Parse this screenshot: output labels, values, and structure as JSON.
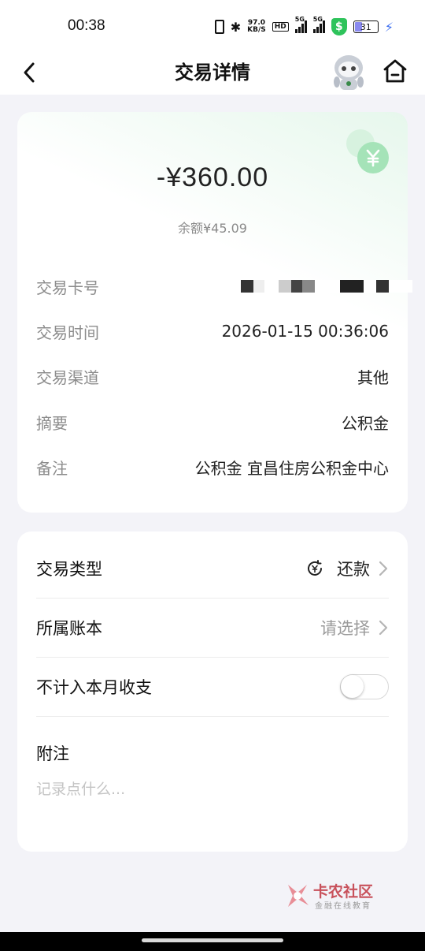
{
  "status_bar": {
    "time": "00:38",
    "net_speed_value": "97.0",
    "net_speed_unit": "KB/S",
    "hd_label": "HD",
    "signal1_label": "5G",
    "signal2_label": "5G",
    "shield_symbol": "$",
    "battery_level": "31",
    "icons": [
      "vibrate-icon",
      "bluetooth-icon",
      "hd-icon",
      "signal-icon",
      "signal-icon",
      "security-shield-icon",
      "battery-icon",
      "charging-icon"
    ]
  },
  "header": {
    "title": "交易详情",
    "back_icon": "chevron-left-icon",
    "assistant_icon": "robot-assistant-icon",
    "home_icon": "home-icon"
  },
  "transaction": {
    "amount": "-¥360.00",
    "balance": "余额¥45.09",
    "category_icon": "yuan-coin-icon",
    "rows": [
      {
        "label": "交易卡号",
        "value": ""
      },
      {
        "label": "交易时间",
        "value": "2026-01-15 00:36:06"
      },
      {
        "label": "交易渠道",
        "value": "其他"
      },
      {
        "label": "摘要",
        "value": "公积金"
      },
      {
        "label": "备注",
        "value": "公积金 宜昌住房公积金中心"
      }
    ]
  },
  "settings": {
    "type_label": "交易类型",
    "type_value": "还款",
    "account_label": "所属账本",
    "account_value": "请选择",
    "exclude_label": "不计入本月收支",
    "exclude_enabled": false,
    "note_label": "附注",
    "note_placeholder": "记录点什么..."
  },
  "colors": {
    "accent_green": "#2ec35b",
    "text_primary": "#222222",
    "text_secondary": "#8c8c8c",
    "page_background": "#f3f3f8"
  },
  "watermark": {
    "main": "卡农社区",
    "sub": "金融在线教育"
  }
}
